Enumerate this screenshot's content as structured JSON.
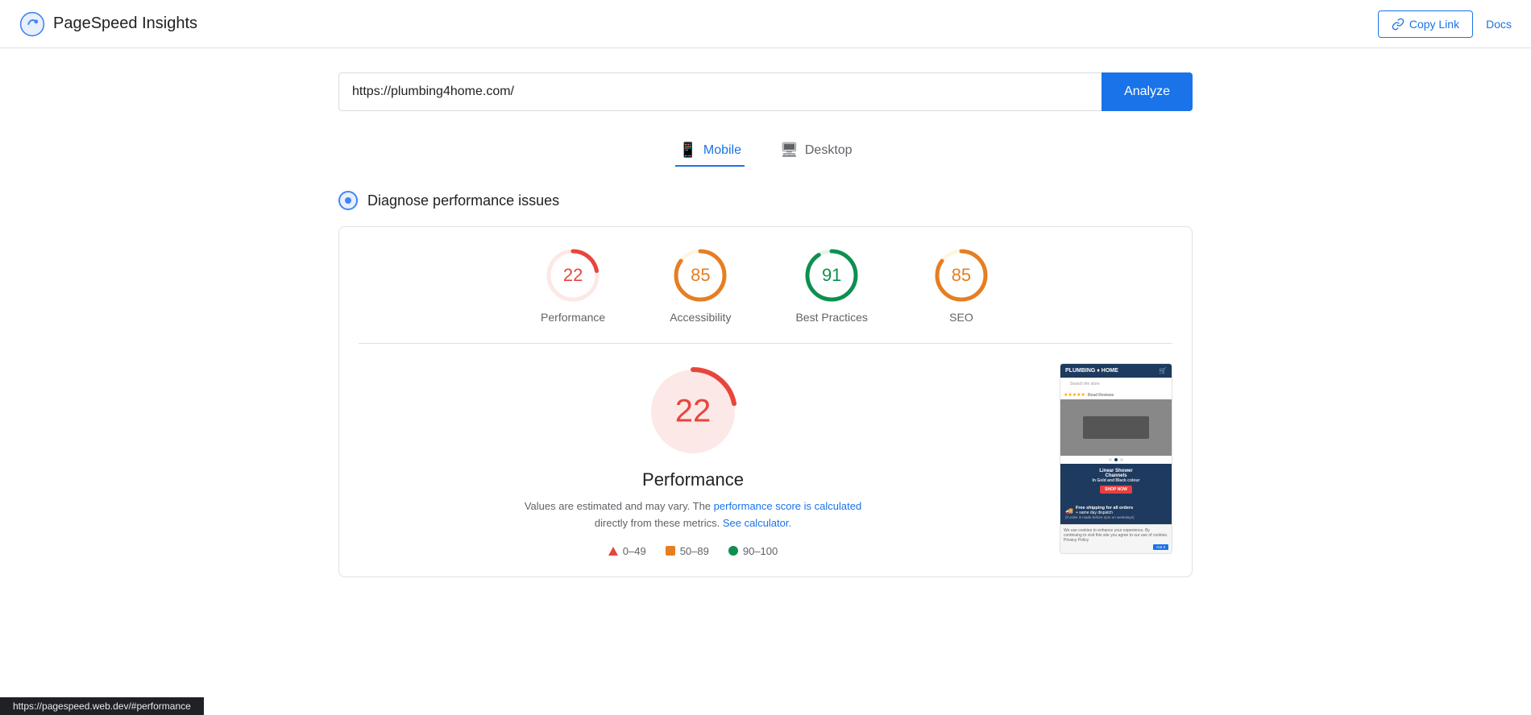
{
  "header": {
    "logo_text": "PageSpeed Insights",
    "copy_link_label": "Copy Link",
    "docs_label": "Docs"
  },
  "url_bar": {
    "url_value": "https://plumbing4home.com/",
    "analyze_label": "Analyze"
  },
  "tabs": [
    {
      "id": "mobile",
      "label": "Mobile",
      "active": true
    },
    {
      "id": "desktop",
      "label": "Desktop",
      "active": false
    }
  ],
  "diagnose": {
    "title": "Diagnose performance issues"
  },
  "scores": [
    {
      "id": "performance",
      "value": 22,
      "label": "Performance",
      "color": "red",
      "pct": 22
    },
    {
      "id": "accessibility",
      "value": 85,
      "label": "Accessibility",
      "color": "orange",
      "pct": 85
    },
    {
      "id": "best-practices",
      "value": 91,
      "label": "Best Practices",
      "color": "green",
      "pct": 91
    },
    {
      "id": "seo",
      "value": 85,
      "label": "SEO",
      "color": "orange",
      "pct": 85
    }
  ],
  "detail": {
    "score_value": "22",
    "score_title": "Performance",
    "description_text": "Values are estimated and may vary. The ",
    "description_link1": "performance score is calculated",
    "description_mid": " directly from these metrics. ",
    "description_link2": "See calculator.",
    "legend": [
      {
        "type": "triangle",
        "range": "0–49"
      },
      {
        "type": "square",
        "range": "50–89"
      },
      {
        "type": "dot",
        "range": "90–100"
      }
    ]
  },
  "status_bar": {
    "url": "https://pagespeed.web.dev/#performance"
  }
}
